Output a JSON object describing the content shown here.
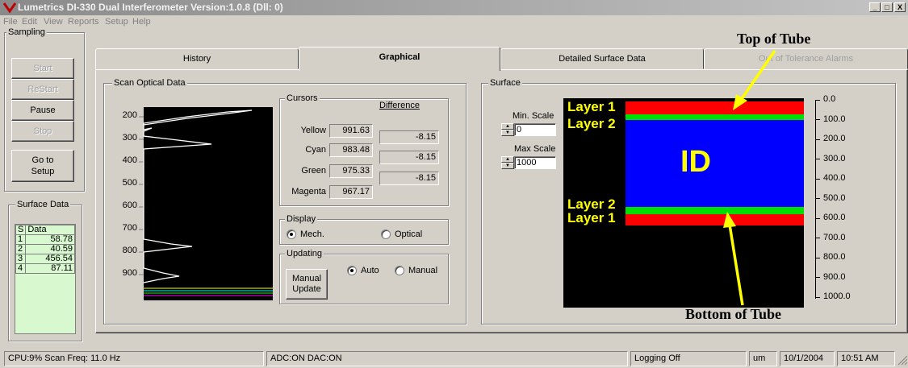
{
  "window": {
    "title": "Lumetrics DI-330 Dual Interferometer  Version:1.0.8 (Dll: 0)",
    "minimize": "_",
    "maximize": "□",
    "close": "X"
  },
  "menu": [
    "File",
    "Edit",
    "View",
    "Reports",
    "Setup",
    "Help"
  ],
  "sampling": {
    "label": "Sampling",
    "start": "Start",
    "restart": "ReStart",
    "pause": "Pause",
    "stop": "Stop",
    "goto_setup_line1": "Go to",
    "goto_setup_line2": "Setup"
  },
  "surface_data": {
    "label": "Surface Data",
    "headers": [
      "S",
      "Data"
    ],
    "rows": [
      [
        "1",
        "58.78"
      ],
      [
        "2",
        "40.59"
      ],
      [
        "3",
        "456.54"
      ],
      [
        "4",
        "87.11"
      ]
    ]
  },
  "tabs": [
    "History",
    "Graphical",
    "Detailed Surface Data",
    "Out of Tolerance Alarms"
  ],
  "scan": {
    "label": "Scan Optical Data",
    "yticks": [
      "200",
      "300",
      "400",
      "500",
      "600",
      "700",
      "800",
      "900"
    ]
  },
  "cursors": {
    "label": "Cursors",
    "difference_label": "Difference",
    "items": [
      {
        "name": "Yellow",
        "value": "991.63"
      },
      {
        "name": "Cyan",
        "value": "983.48"
      },
      {
        "name": "Green",
        "value": "975.33"
      },
      {
        "name": "Magenta",
        "value": "967.17"
      }
    ],
    "differences": [
      "-8.15",
      "-8.15",
      "-8.15"
    ]
  },
  "display": {
    "label": "Display",
    "mech": "Mech.",
    "optical": "Optical",
    "selected": "Mech."
  },
  "updating": {
    "label": "Updating",
    "auto": "Auto",
    "manual": "Manual",
    "selected": "Auto",
    "manual_update_line1": "Manual",
    "manual_update_line2": "Update"
  },
  "surface": {
    "label": "Surface",
    "min_scale_label": "Min. Scale",
    "min_scale_value": "0",
    "max_scale_label": "Max Scale",
    "max_scale_value": "1000",
    "id_label": "ID",
    "layer_labels": [
      "Layer 1",
      "Layer 2",
      "Layer 2",
      "Layer 1"
    ],
    "scale_ticks": [
      "0.0",
      "100.0",
      "200.0",
      "300.0",
      "400.0",
      "500.0",
      "600.0",
      "700.0",
      "800.0",
      "900.0",
      "1000.0"
    ],
    "colors": {
      "layer1": "#ff0000",
      "layer2": "#00e000",
      "id": "#0000ff",
      "background": "#000000"
    }
  },
  "annotations": {
    "top": "Top of Tube",
    "bottom": "Bottom of Tube"
  },
  "status": {
    "cpu": "CPU:9% Scan Freq: 11.0 Hz",
    "adc": "ADC:ON DAC:ON",
    "logging": "Logging Off",
    "units": "um",
    "date": "10/1/2004",
    "time": "10:51 AM"
  }
}
